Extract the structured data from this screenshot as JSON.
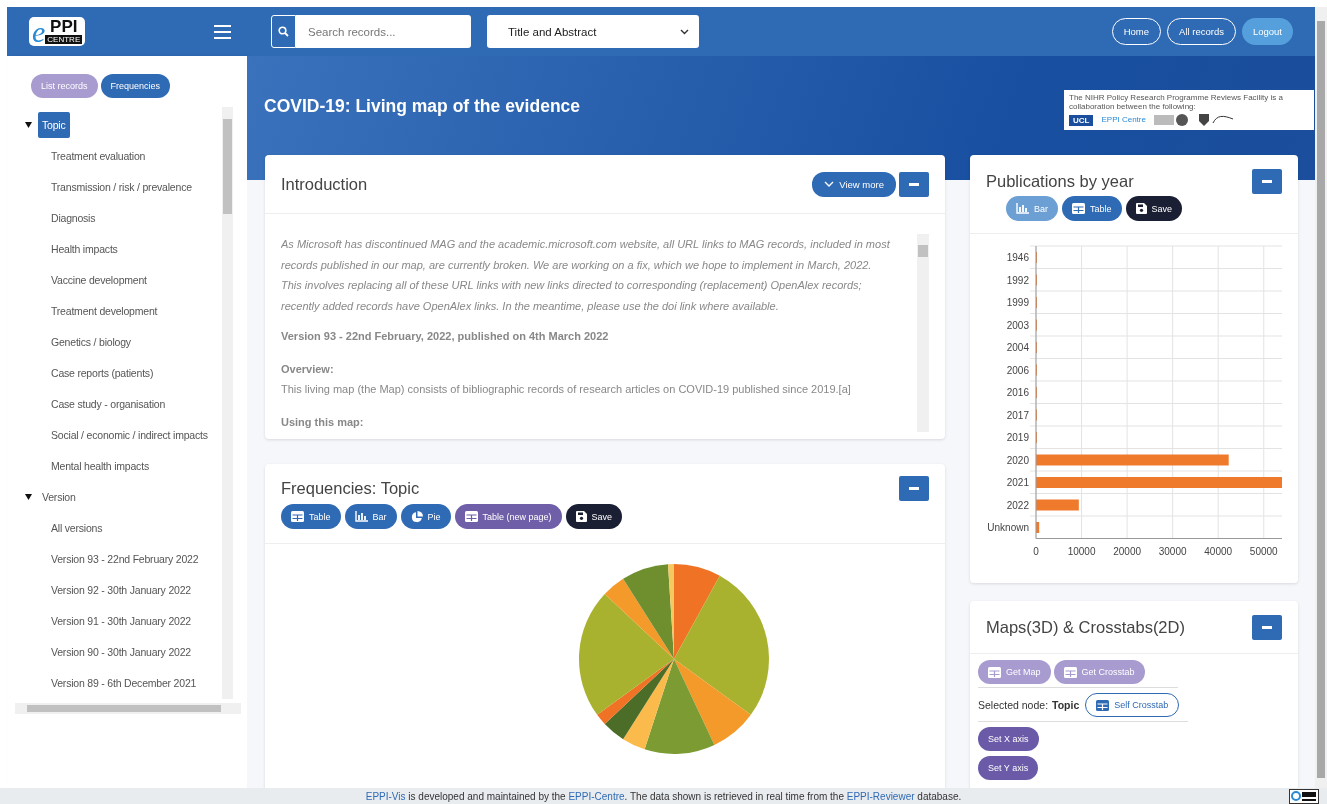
{
  "logo": {
    "mark": "e",
    "name": "PPI",
    "sub": "CENTRE"
  },
  "search": {
    "placeholder": "Search records..."
  },
  "search_scope": {
    "value": "Title and Abstract"
  },
  "nav_buttons": [
    {
      "label": "Home",
      "kind": "outline"
    },
    {
      "label": "All records",
      "kind": "outline"
    },
    {
      "label": "Logout",
      "kind": "filled"
    }
  ],
  "sidebar": {
    "buttons": [
      {
        "label": "List records",
        "selected": false
      },
      {
        "label": "Frequencies",
        "selected": true
      }
    ],
    "tree": [
      {
        "label": "Topic",
        "selected": true,
        "expanded": true,
        "children": [
          {
            "label": "Treatment evaluation",
            "selected": false
          },
          {
            "label": "Transmission / risk / prevalence",
            "selected": false
          },
          {
            "label": "Diagnosis",
            "selected": false
          },
          {
            "label": "Health impacts",
            "selected": false
          },
          {
            "label": "Vaccine development",
            "selected": false
          },
          {
            "label": "Treatment development",
            "selected": false
          },
          {
            "label": "Genetics / biology",
            "selected": false
          },
          {
            "label": "Case reports (patients)",
            "selected": false
          },
          {
            "label": "Case study - organisation",
            "selected": false
          },
          {
            "label": "Social / economic / indirect impacts",
            "selected": false
          },
          {
            "label": "Mental health impacts",
            "selected": false
          }
        ]
      },
      {
        "label": "Version",
        "selected": false,
        "expanded": true,
        "children": [
          {
            "label": "All versions",
            "selected": false
          },
          {
            "label": "Version 93 - 22nd February 2022",
            "selected": false
          },
          {
            "label": "Version 92 - 30th January 2022",
            "selected": false
          },
          {
            "label": "Version 91 - 30th January 2022",
            "selected": false
          },
          {
            "label": "Version 90 - 30th January 2022",
            "selected": false
          },
          {
            "label": "Version 89 - 6th December 2021",
            "selected": false
          }
        ]
      }
    ]
  },
  "banner": {
    "title": "COVID-19: Living map of the evidence",
    "partner_note": "The NIHR Policy Research Programme Reviews Facility is a collaboration between the following:",
    "partner_logos": [
      "UCL",
      "EPPI Centre"
    ]
  },
  "introduction": {
    "title": "Introduction",
    "view_more": "View more",
    "paragraphs": [
      {
        "kind": "notice",
        "text": "As Microsoft has discontinued MAG and the academic.microsoft.com website, all URL links to MAG records, included in most records published in our map, are currently broken. We are working on a fix, which we hope to implement in March, 2022. This involves replacing all of these URL links with new links directed to corresponding (replacement) OpenAlex records; recently added records have OpenAlex links. In the meantime, please use the doi link where available."
      },
      {
        "kind": "heading",
        "text": "Version 93 - 22nd February, 2022, published on 4th March 2022"
      },
      {
        "kind": "subheading",
        "text": "Overview:"
      },
      {
        "kind": "body",
        "text": "This living map (the Map) consists of bibliographic records of research articles on COVID-19 published since 2019.[a]"
      },
      {
        "kind": "heading",
        "text": "Using this map:"
      }
    ]
  },
  "frequencies": {
    "title": "Frequencies: Topic",
    "buttons": [
      {
        "label": "Table",
        "kind": "table"
      },
      {
        "label": "Bar",
        "kind": "bar"
      },
      {
        "label": "Pie",
        "kind": "pie"
      },
      {
        "label": "Table (new page)",
        "kind": "table-new"
      },
      {
        "label": "Save",
        "kind": "save"
      }
    ]
  },
  "publications": {
    "title": "Publications by year",
    "buttons": [
      {
        "label": "Bar",
        "kind": "bar",
        "selected": true
      },
      {
        "label": "Table",
        "kind": "table",
        "selected": false
      },
      {
        "label": "Save",
        "kind": "save",
        "selected": false
      }
    ],
    "chart_data": {
      "type": "bar",
      "orientation": "horizontal",
      "categories": [
        "1946",
        "1992",
        "1999",
        "2003",
        "2004",
        "2006",
        "2016",
        "2017",
        "2019",
        "2020",
        "2021",
        "2022",
        "Unknown"
      ],
      "series": [
        {
          "color": "#f07a2c",
          "values": [
            0,
            0,
            0,
            0,
            0,
            0,
            0,
            0,
            0,
            42300,
            54000,
            9400,
            700
          ]
        }
      ],
      "grid": true,
      "xlim": [
        0,
        54000
      ],
      "xticks": [
        0,
        10000,
        20000,
        30000,
        40000,
        50000
      ]
    }
  },
  "maps": {
    "title": "Maps(3D) & Crosstabs(2D)",
    "buttons": [
      {
        "label": "Get Map"
      },
      {
        "label": "Get Crosstab"
      }
    ],
    "selected_node_label": "Selected node:",
    "selected_node": "Topic",
    "self_crosstab": "Self Crosstab",
    "axis_buttons": [
      {
        "label": "Set X axis"
      },
      {
        "label": "Set Y axis"
      }
    ]
  },
  "footer": {
    "parts": [
      {
        "text": "EPPI-Vis",
        "link": true
      },
      {
        "text": " is developed and maintained by the ",
        "link": false
      },
      {
        "text": "EPPI-Centre",
        "link": true
      },
      {
        "text": ". The data shown is retrieved in real time from the ",
        "link": false
      },
      {
        "text": "EPPI-Reviewer",
        "link": true
      },
      {
        "text": " database.",
        "link": false
      }
    ]
  }
}
